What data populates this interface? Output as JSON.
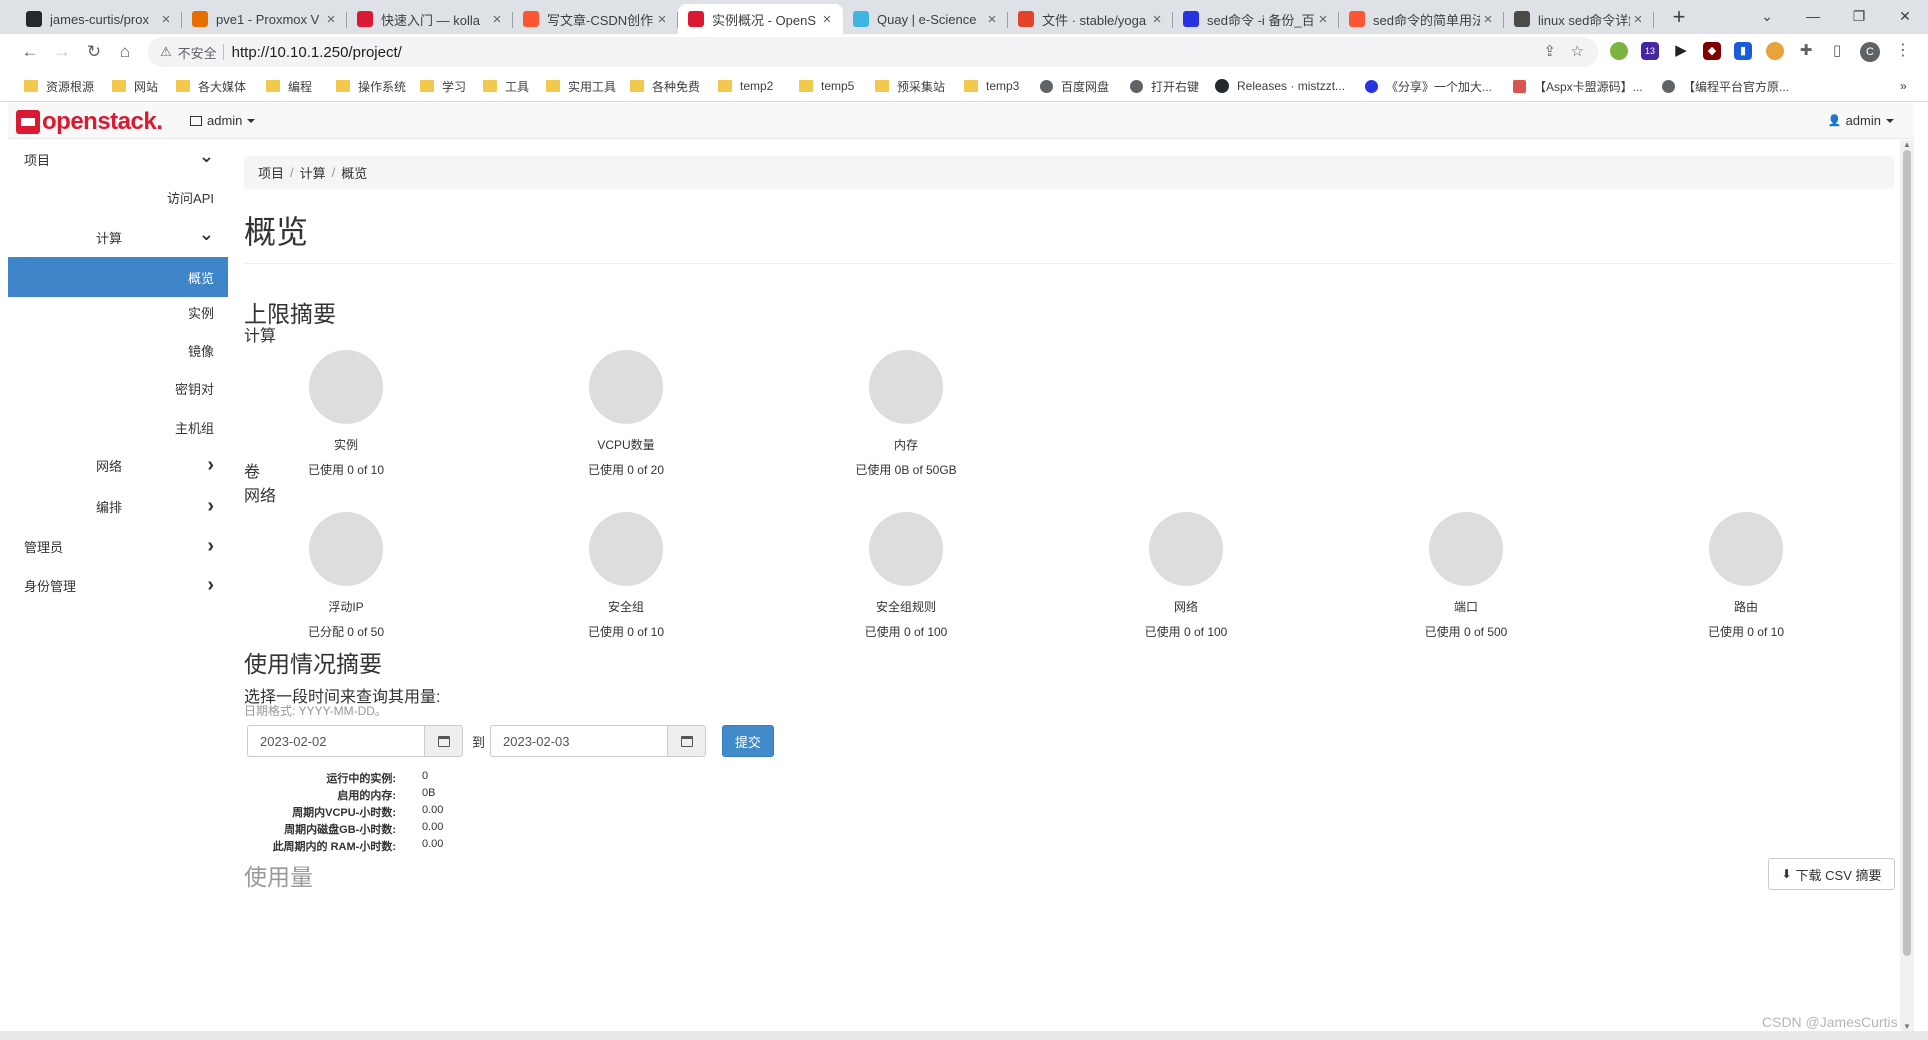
{
  "browser": {
    "tabs": [
      {
        "title": "james-curtis/prox",
        "icon_color": "#24292e",
        "icon": "github-icon"
      },
      {
        "title": "pve1 - Proxmox V",
        "icon_color": "#e57000",
        "icon": "proxmox-icon"
      },
      {
        "title": "快速入门 — kolla",
        "icon_color": "#da1a32",
        "icon": "openstack-icon"
      },
      {
        "title": "写文章-CSDN创作",
        "icon_color": "#fc5531",
        "icon": "csdn-icon"
      },
      {
        "title": "实例概况 - OpenS",
        "icon_color": "#da1a32",
        "icon": "openstack-icon",
        "active": true
      },
      {
        "title": "Quay | e-Science",
        "icon_color": "#40b4e5",
        "icon": "quay-icon"
      },
      {
        "title": "文件 · stable/yoga",
        "icon_color": "#e24329",
        "icon": "gitlab-icon"
      },
      {
        "title": "sed命令 -i 备份_百",
        "icon_color": "#2932e1",
        "icon": "baidu-icon"
      },
      {
        "title": "sed命令的简单用法",
        "icon_color": "#fc5531",
        "icon": "csdn-icon"
      },
      {
        "title": "linux sed命令详解",
        "icon_color": "#4a4a4a",
        "icon": "web-icon"
      }
    ],
    "security_label": "不安全",
    "url": "http://10.10.1.250/project/",
    "bookmarks": [
      {
        "label": "资源根源",
        "type": "folder"
      },
      {
        "label": "网站",
        "type": "folder"
      },
      {
        "label": "各大媒体",
        "type": "folder"
      },
      {
        "label": "编程",
        "type": "folder"
      },
      {
        "label": "操作系统",
        "type": "folder"
      },
      {
        "label": "学习",
        "type": "folder"
      },
      {
        "label": "工具",
        "type": "folder"
      },
      {
        "label": "实用工具",
        "type": "folder"
      },
      {
        "label": "各种免费",
        "type": "folder"
      },
      {
        "label": "temp2",
        "type": "folder"
      },
      {
        "label": "temp5",
        "type": "folder"
      },
      {
        "label": "预采集站",
        "type": "folder"
      },
      {
        "label": "temp3",
        "type": "folder"
      },
      {
        "label": "百度网盘",
        "type": "globe"
      },
      {
        "label": "打开右键",
        "type": "globe"
      },
      {
        "label": "Releases · mistzzt...",
        "type": "gh"
      },
      {
        "label": "《分享》一个加大...",
        "type": "paw"
      },
      {
        "label": "【Aspx卡盟源码】...",
        "type": "aspx"
      },
      {
        "label": "【编程平台官方原...",
        "type": "globe"
      }
    ],
    "extension_badge": "13",
    "profile_initial": "C"
  },
  "header": {
    "brand": "openstack.",
    "project": "admin",
    "user": "admin"
  },
  "sidebar": {
    "items": [
      {
        "label": "项目",
        "chevron": "down"
      },
      {
        "label": "访问API"
      },
      {
        "label": "计算",
        "chevron": "down"
      },
      {
        "label": "概览",
        "active": true
      },
      {
        "label": "实例"
      },
      {
        "label": "镜像"
      },
      {
        "label": "密钥对"
      },
      {
        "label": "主机组"
      },
      {
        "label": "网络",
        "chevron": "right"
      },
      {
        "label": "编排",
        "chevron": "right"
      },
      {
        "label": "管理员",
        "chevron": "right"
      },
      {
        "label": "身份管理",
        "chevron": "right"
      }
    ]
  },
  "main": {
    "breadcrumb": [
      "项目",
      "计算",
      "概览"
    ],
    "title": "概览",
    "limit_summary_title": "上限摘要",
    "compute_title": "计算",
    "compute": [
      {
        "label": "实例",
        "value": "已使用 0 of 10",
        "used": 0,
        "max": 10
      },
      {
        "label": "VCPU数量",
        "value": "已使用 0 of 20",
        "used": 0,
        "max": 20
      },
      {
        "label": "内存",
        "value": "已使用 0B of 50GB",
        "used": 0,
        "max": 50
      }
    ],
    "volume_title": "卷",
    "network_title": "网络",
    "network": [
      {
        "label": "浮动IP",
        "value": "已分配 0 of 50",
        "used": 0,
        "max": 50
      },
      {
        "label": "安全组",
        "value": "已使用 0 of 10",
        "used": 0,
        "max": 10
      },
      {
        "label": "安全组规则",
        "value": "已使用 0 of 100",
        "used": 0,
        "max": 100
      },
      {
        "label": "网络",
        "value": "已使用 0 of 100",
        "used": 0,
        "max": 100
      },
      {
        "label": "端口",
        "value": "已使用 0 of 500",
        "used": 0,
        "max": 500
      },
      {
        "label": "路由",
        "value": "已使用 0 of 10",
        "used": 0,
        "max": 10
      }
    ],
    "usage_summary_title": "使用情况摘要",
    "query_label": "选择一段时间来查询其用量:",
    "date_hint": "日期格式: YYYY-MM-DD。",
    "start_date": "2023-02-02",
    "to_label": "到",
    "end_date": "2023-02-03",
    "submit_label": "提交",
    "stats": [
      {
        "k": "运行中的实例:",
        "v": "0"
      },
      {
        "k": "启用的内存:",
        "v": "0B"
      },
      {
        "k": "周期内VCPU-小时数:",
        "v": "0.00"
      },
      {
        "k": "周期内磁盘GB-小时数:",
        "v": "0.00"
      },
      {
        "k": "此周期内的 RAM-小时数:",
        "v": "0.00"
      }
    ],
    "usage_title": "使用量",
    "csv_label": "下载 CSV 摘要"
  },
  "watermark": "CSDN @JamesCurtis"
}
